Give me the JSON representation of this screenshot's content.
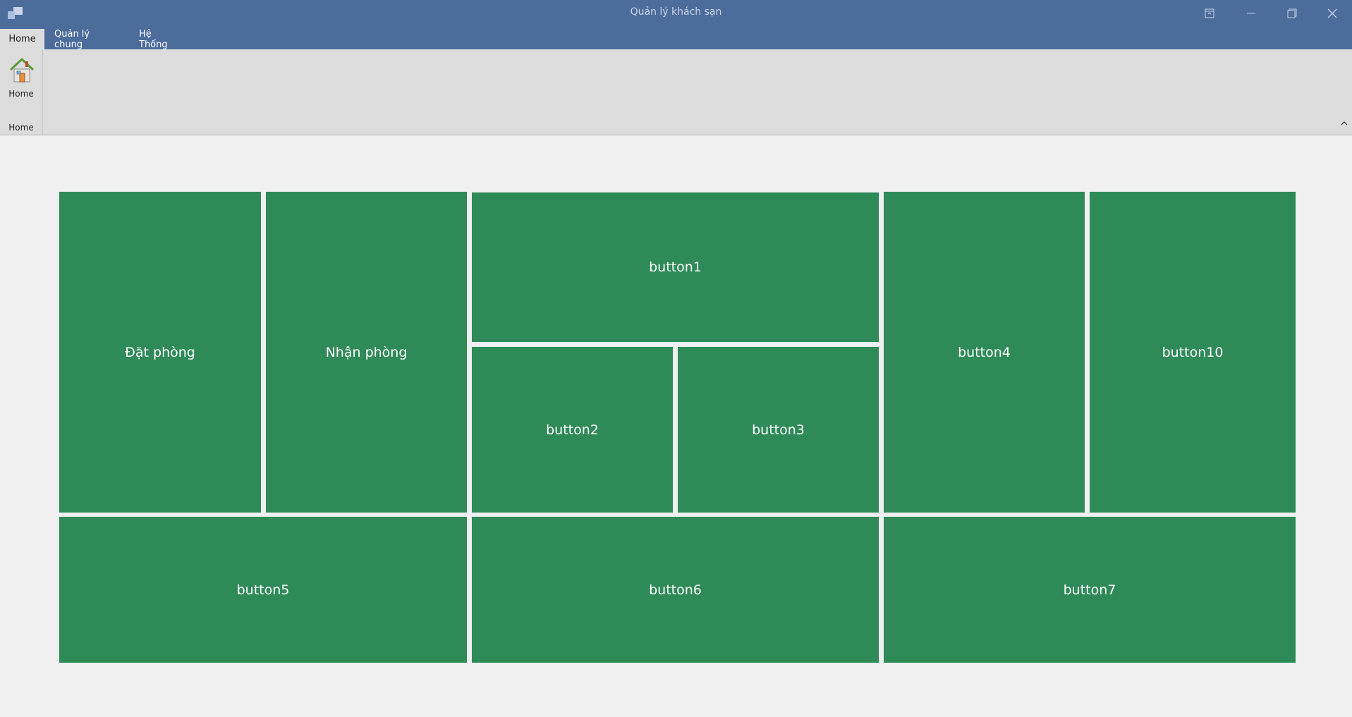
{
  "window": {
    "title": "Quản lý khách sạn"
  },
  "menu": {
    "tabs": [
      "Home",
      "Quản lý chung",
      "Hệ Thống"
    ]
  },
  "ribbon": {
    "home_button_label": "Home",
    "group_label": "Home"
  },
  "tiles": {
    "dat_phong": "Đặt phòng",
    "nhan_phong": "Nhận phòng",
    "button1": "button1",
    "button2": "button2",
    "button3": "button3",
    "button4": "button4",
    "button10": "button10",
    "button5": "button5",
    "button6": "button6",
    "button7": "button7"
  },
  "colors": {
    "titlebar": "#4c6c9c",
    "ribbon": "#dcdcdc",
    "tile": "#2e8b57",
    "background": "#f0f0f0"
  }
}
